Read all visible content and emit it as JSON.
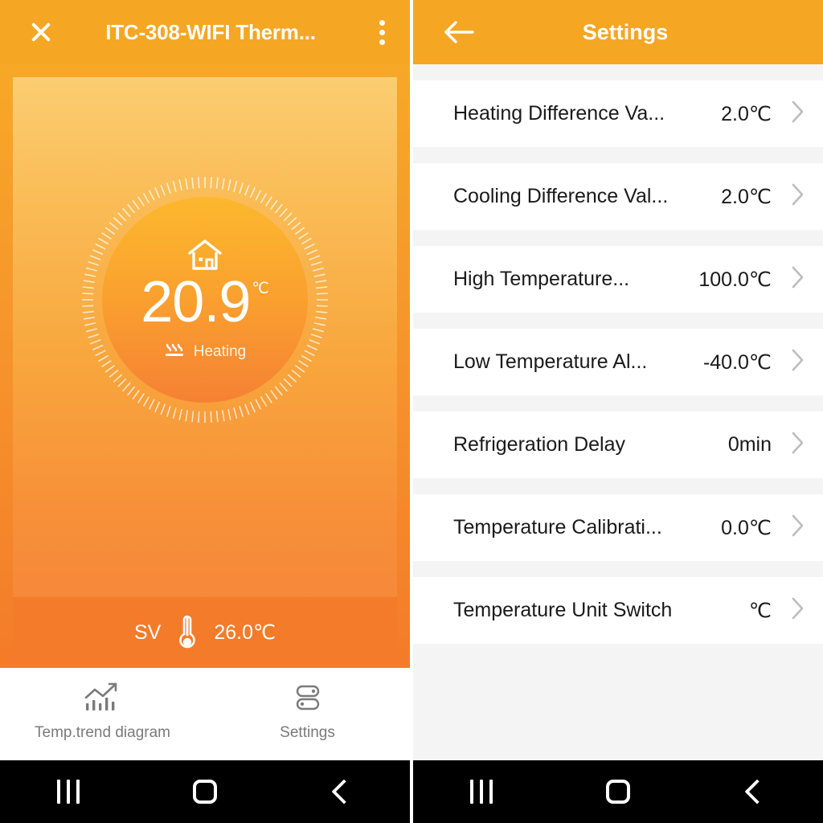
{
  "device_panel": {
    "header": {
      "close_icon": "close-icon",
      "title": "ITC-308-WIFI Therm...",
      "menu_icon": "more-vertical-icon",
      "background_color": "#F5A623"
    },
    "dial": {
      "home_icon": "home-icon",
      "temperature": "20.9",
      "unit": "℃",
      "mode_icon": "heating-icon",
      "mode_label": "Heating",
      "ring_icon": "tick-ring",
      "gradient_top": "#FCB82E",
      "gradient_bottom": "#F58134"
    },
    "setpoint": {
      "label": "SV",
      "thermometer_icon": "thermometer-icon",
      "value": "26.0℃",
      "background_color": "#F47B29"
    },
    "tabs": [
      {
        "icon": "trend-chart-icon",
        "label": "Temp.trend diagram"
      },
      {
        "icon": "sliders-icon",
        "label": "Settings"
      }
    ]
  },
  "settings_panel": {
    "header": {
      "back_icon": "arrow-left-icon",
      "title": "Settings",
      "background_color": "#F5A623"
    },
    "rows": [
      {
        "label": "Heating Difference Va...",
        "value": "2.0℃",
        "chevron": "chevron-right-icon"
      },
      {
        "label": "Cooling Difference Val...",
        "value": "2.0℃",
        "chevron": "chevron-right-icon"
      },
      {
        "label": "High Temperature...",
        "value": "100.0℃",
        "chevron": "chevron-right-icon"
      },
      {
        "label": "Low Temperature Al...",
        "value": "-40.0℃",
        "chevron": "chevron-right-icon"
      },
      {
        "label": "Refrigeration Delay",
        "value": "0min",
        "chevron": "chevron-right-icon"
      },
      {
        "label": "Temperature Calibrati...",
        "value": "0.0℃",
        "chevron": "chevron-right-icon"
      },
      {
        "label": "Temperature Unit Switch",
        "value": "℃",
        "chevron": "chevron-right-icon"
      }
    ]
  },
  "navbar": {
    "recents_icon": "recents-icon",
    "home_icon": "home-button-icon",
    "back_icon": "back-button-icon"
  }
}
